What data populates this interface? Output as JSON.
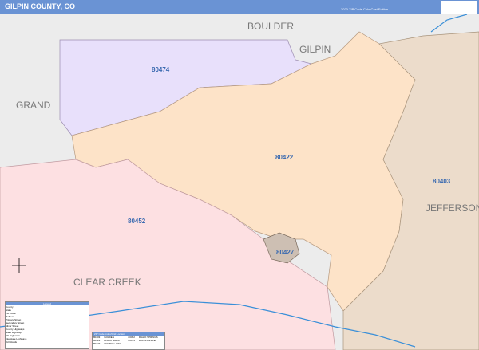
{
  "header": {
    "title": "GILPIN COUNTY, CO",
    "edition": "2020 ZIP Code ColorCast Edition",
    "logo_text": "Market MAPS"
  },
  "map": {
    "regions": [
      {
        "label": "80474",
        "color": "#e8e0fb"
      },
      {
        "label": "80422",
        "color": "#fde3c8"
      },
      {
        "label": "80452",
        "color": "#fde0e2"
      },
      {
        "label": "80403",
        "color": "#ecdccb"
      },
      {
        "label": "80427",
        "color": "#cdbfb3"
      }
    ],
    "counties": [
      "BOULDER",
      "GILPIN",
      "GRAND",
      "CLEAR CREEK",
      "JEFFERSON"
    ],
    "outside_color": "#ececec"
  },
  "legend": {
    "title": "Legend",
    "items": [
      "County",
      "State",
      "ZIP Code",
      "Railroad",
      "Primary Street",
      "Secondary Street",
      "Minor Street",
      "County Highways",
      "State Highways",
      "US Highways",
      "Interstate Highways",
      "Toll Roads"
    ]
  },
  "index": {
    "title": "ZIP Code Index/Grid Locator",
    "rows": [
      [
        "80403",
        "GOLDEN",
        "80452",
        "IDAHO SPRINGS"
      ],
      [
        "80422",
        "BLACK HAWK",
        "80474",
        "ROLLINSVILLE"
      ],
      [
        "80427",
        "CENTRAL CITY",
        "",
        ""
      ]
    ]
  }
}
